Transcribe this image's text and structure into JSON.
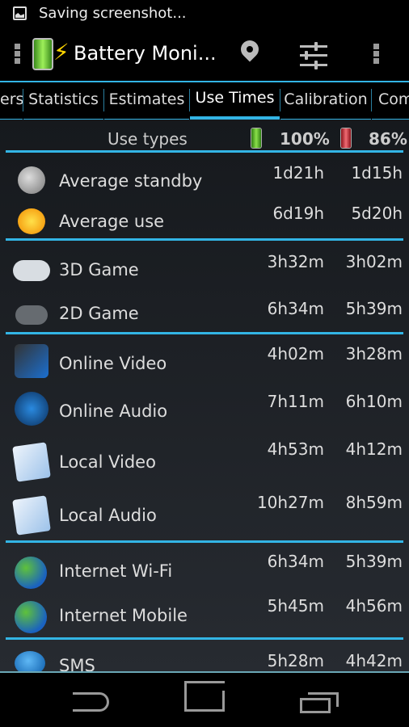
{
  "status_bar": {
    "notification": "Saving screenshot...",
    "icon": "image-icon"
  },
  "action_bar": {
    "title": "Battery Moni...",
    "icons": [
      "overflow-left-icon",
      "battery-logo-icon",
      "location-pin-icon",
      "sliders-icon",
      "overflow-menu-icon"
    ]
  },
  "tabs": [
    {
      "label": "ers"
    },
    {
      "label": "Statistics"
    },
    {
      "label": "Estimates"
    },
    {
      "label": "Use Times",
      "selected": true
    },
    {
      "label": "Calibration"
    },
    {
      "label": "Com"
    }
  ],
  "header": {
    "label": "Use types",
    "col1": "100%",
    "col2": "86%",
    "col1_color": "#4caf1a",
    "col2_color": "#d0222e"
  },
  "accent": "#33b5e5",
  "rows": [
    {
      "label": "Average standby",
      "v1": "1d21h",
      "v2": "1d15h",
      "icon": "moon-icon"
    },
    {
      "label": "Average use",
      "v1": "6d19h",
      "v2": "5d20h",
      "icon": "sun-icon"
    },
    {
      "label": "3D Game",
      "v1": "3h32m",
      "v2": "3h02m",
      "icon": "gamepad-white-icon"
    },
    {
      "label": "2D Game",
      "v1": "6h34m",
      "v2": "5h39m",
      "icon": "gamepad-grey-icon"
    },
    {
      "label": "Online Video",
      "v1": "4h02m",
      "v2": "3h28m",
      "icon": "online-video-camera-icon"
    },
    {
      "label": "Online Audio",
      "v1": "7h11m",
      "v2": "6h10m",
      "icon": "online-headphones-icon"
    },
    {
      "label": "Local Video",
      "v1": "4h53m",
      "v2": "4h12m",
      "icon": "local-video-camera-icon"
    },
    {
      "label": "Local Audio",
      "v1": "10h27m",
      "v2": "8h59m",
      "icon": "local-headphones-icon"
    },
    {
      "label": "Internet Wi-Fi",
      "v1": "6h34m",
      "v2": "5h39m",
      "icon": "globe-icon"
    },
    {
      "label": "Internet Mobile",
      "v1": "5h45m",
      "v2": "4h56m",
      "icon": "globe-icon"
    },
    {
      "label": "SMS",
      "v1": "5h28m",
      "v2": "4h42m",
      "icon": "sms-icon"
    }
  ],
  "nav_bar": {
    "icons": [
      "back-icon",
      "home-icon",
      "recent-apps-icon"
    ]
  }
}
